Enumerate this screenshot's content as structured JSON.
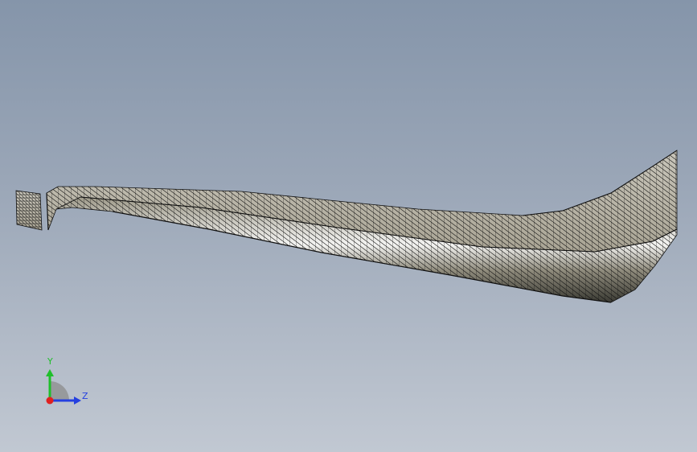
{
  "viewport": {
    "background_top": "#8595aa",
    "background_bottom": "#c1c8d2",
    "mesh_color": "#000000",
    "surface_color": "#b9b4a3"
  },
  "triad": {
    "y_label": "Y",
    "z_label": "Z",
    "y_color": "#1fbf2a",
    "z_color": "#2540e0",
    "x_color": "#e02020"
  }
}
